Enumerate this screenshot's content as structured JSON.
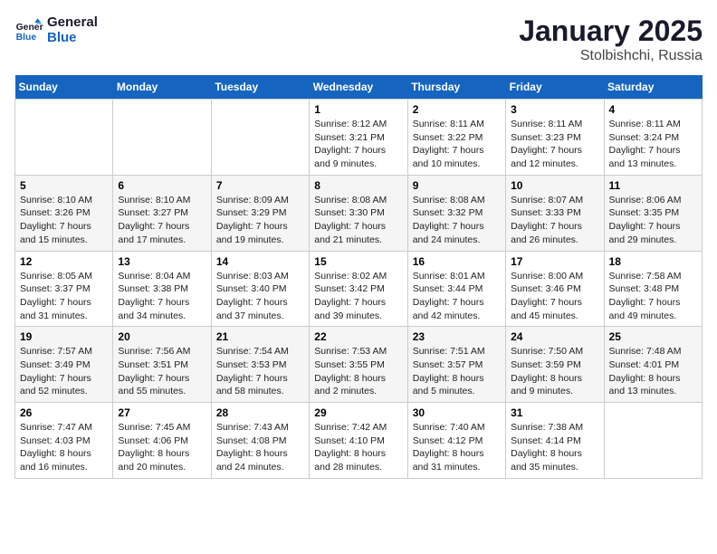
{
  "logo": {
    "line1": "General",
    "line2": "Blue"
  },
  "title": "January 2025",
  "subtitle": "Stolbishchi, Russia",
  "days_header": [
    "Sunday",
    "Monday",
    "Tuesday",
    "Wednesday",
    "Thursday",
    "Friday",
    "Saturday"
  ],
  "weeks": [
    [
      {
        "day": "",
        "info": ""
      },
      {
        "day": "",
        "info": ""
      },
      {
        "day": "",
        "info": ""
      },
      {
        "day": "1",
        "info": "Sunrise: 8:12 AM\nSunset: 3:21 PM\nDaylight: 7 hours\nand 9 minutes."
      },
      {
        "day": "2",
        "info": "Sunrise: 8:11 AM\nSunset: 3:22 PM\nDaylight: 7 hours\nand 10 minutes."
      },
      {
        "day": "3",
        "info": "Sunrise: 8:11 AM\nSunset: 3:23 PM\nDaylight: 7 hours\nand 12 minutes."
      },
      {
        "day": "4",
        "info": "Sunrise: 8:11 AM\nSunset: 3:24 PM\nDaylight: 7 hours\nand 13 minutes."
      }
    ],
    [
      {
        "day": "5",
        "info": "Sunrise: 8:10 AM\nSunset: 3:26 PM\nDaylight: 7 hours\nand 15 minutes."
      },
      {
        "day": "6",
        "info": "Sunrise: 8:10 AM\nSunset: 3:27 PM\nDaylight: 7 hours\nand 17 minutes."
      },
      {
        "day": "7",
        "info": "Sunrise: 8:09 AM\nSunset: 3:29 PM\nDaylight: 7 hours\nand 19 minutes."
      },
      {
        "day": "8",
        "info": "Sunrise: 8:08 AM\nSunset: 3:30 PM\nDaylight: 7 hours\nand 21 minutes."
      },
      {
        "day": "9",
        "info": "Sunrise: 8:08 AM\nSunset: 3:32 PM\nDaylight: 7 hours\nand 24 minutes."
      },
      {
        "day": "10",
        "info": "Sunrise: 8:07 AM\nSunset: 3:33 PM\nDaylight: 7 hours\nand 26 minutes."
      },
      {
        "day": "11",
        "info": "Sunrise: 8:06 AM\nSunset: 3:35 PM\nDaylight: 7 hours\nand 29 minutes."
      }
    ],
    [
      {
        "day": "12",
        "info": "Sunrise: 8:05 AM\nSunset: 3:37 PM\nDaylight: 7 hours\nand 31 minutes."
      },
      {
        "day": "13",
        "info": "Sunrise: 8:04 AM\nSunset: 3:38 PM\nDaylight: 7 hours\nand 34 minutes."
      },
      {
        "day": "14",
        "info": "Sunrise: 8:03 AM\nSunset: 3:40 PM\nDaylight: 7 hours\nand 37 minutes."
      },
      {
        "day": "15",
        "info": "Sunrise: 8:02 AM\nSunset: 3:42 PM\nDaylight: 7 hours\nand 39 minutes."
      },
      {
        "day": "16",
        "info": "Sunrise: 8:01 AM\nSunset: 3:44 PM\nDaylight: 7 hours\nand 42 minutes."
      },
      {
        "day": "17",
        "info": "Sunrise: 8:00 AM\nSunset: 3:46 PM\nDaylight: 7 hours\nand 45 minutes."
      },
      {
        "day": "18",
        "info": "Sunrise: 7:58 AM\nSunset: 3:48 PM\nDaylight: 7 hours\nand 49 minutes."
      }
    ],
    [
      {
        "day": "19",
        "info": "Sunrise: 7:57 AM\nSunset: 3:49 PM\nDaylight: 7 hours\nand 52 minutes."
      },
      {
        "day": "20",
        "info": "Sunrise: 7:56 AM\nSunset: 3:51 PM\nDaylight: 7 hours\nand 55 minutes."
      },
      {
        "day": "21",
        "info": "Sunrise: 7:54 AM\nSunset: 3:53 PM\nDaylight: 7 hours\nand 58 minutes."
      },
      {
        "day": "22",
        "info": "Sunrise: 7:53 AM\nSunset: 3:55 PM\nDaylight: 8 hours\nand 2 minutes."
      },
      {
        "day": "23",
        "info": "Sunrise: 7:51 AM\nSunset: 3:57 PM\nDaylight: 8 hours\nand 5 minutes."
      },
      {
        "day": "24",
        "info": "Sunrise: 7:50 AM\nSunset: 3:59 PM\nDaylight: 8 hours\nand 9 minutes."
      },
      {
        "day": "25",
        "info": "Sunrise: 7:48 AM\nSunset: 4:01 PM\nDaylight: 8 hours\nand 13 minutes."
      }
    ],
    [
      {
        "day": "26",
        "info": "Sunrise: 7:47 AM\nSunset: 4:03 PM\nDaylight: 8 hours\nand 16 minutes."
      },
      {
        "day": "27",
        "info": "Sunrise: 7:45 AM\nSunset: 4:06 PM\nDaylight: 8 hours\nand 20 minutes."
      },
      {
        "day": "28",
        "info": "Sunrise: 7:43 AM\nSunset: 4:08 PM\nDaylight: 8 hours\nand 24 minutes."
      },
      {
        "day": "29",
        "info": "Sunrise: 7:42 AM\nSunset: 4:10 PM\nDaylight: 8 hours\nand 28 minutes."
      },
      {
        "day": "30",
        "info": "Sunrise: 7:40 AM\nSunset: 4:12 PM\nDaylight: 8 hours\nand 31 minutes."
      },
      {
        "day": "31",
        "info": "Sunrise: 7:38 AM\nSunset: 4:14 PM\nDaylight: 8 hours\nand 35 minutes."
      },
      {
        "day": "",
        "info": ""
      }
    ]
  ]
}
